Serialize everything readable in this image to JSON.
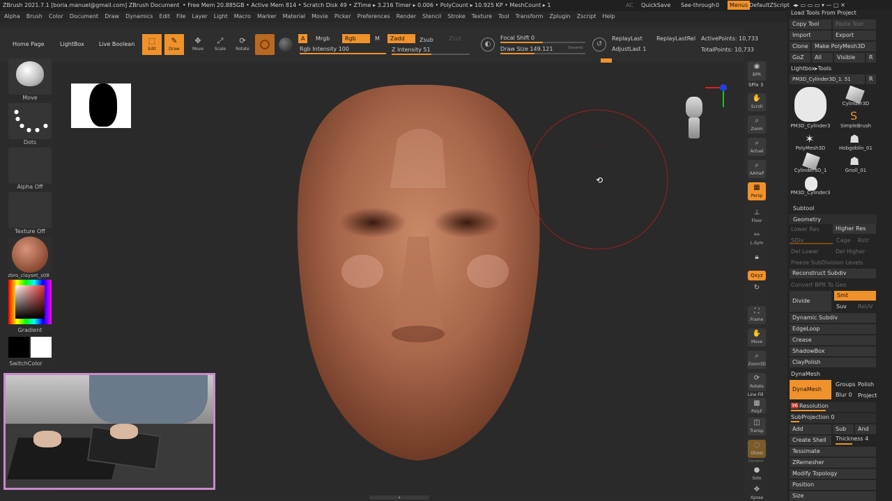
{
  "titlebar": {
    "title": "ZBrush 2021.7.1 [boria.manuel@gmail.com]  ZBrush Document",
    "stats": "• Free Mem 20.885GB • Active Mem 814 • Scratch Disk 49 • ZTime ▸ 3.216 Timer ▸ 0.006 • PolyCount ▸ 10.925 KP • MeshCount ▸ 1",
    "ac": "AC",
    "quicksave": "QuickSave",
    "seethrough": "See-through",
    "seethrough_value": "0",
    "menus": "Menus",
    "zscript": "DefaultZScript"
  },
  "menubar": {
    "items": [
      "Alpha",
      "Brush",
      "Color",
      "Document",
      "Draw",
      "Dynamics",
      "Edit",
      "File",
      "Layer",
      "Light",
      "Macro",
      "Marker",
      "Material",
      "Movie",
      "Picker",
      "Preferences",
      "Render",
      "Stencil",
      "Stroke",
      "Texture",
      "Tool",
      "Transform",
      "Zplugin",
      "Zscript",
      "Help"
    ]
  },
  "toolbar": {
    "home_page": "Home Page",
    "lightbox": "LightBox",
    "live_boolean": "Live Boolean",
    "edit": "Edit",
    "draw": "Draw",
    "move": "Move",
    "scale": "Scale",
    "rotate": "Rotate",
    "a_label": "A",
    "mrgb": "Mrgb",
    "rgb": "Rgb",
    "m": "M",
    "zadd": "Zadd",
    "zsub": "Zsub",
    "zcut": "Zcut",
    "rgb_intensity": "Rgb Intensity 100",
    "z_intensity": "Z Intensity 51",
    "focal_shift": "Focal Shift 0",
    "draw_size": "Draw Size 149.121",
    "dynamic": "Dynamic",
    "replay_last": "ReplayLast",
    "replay_last_rel": "ReplayLastRel",
    "adjust_last": "AdjustLast 1",
    "active_points": "ActivePoints: 10,733",
    "total_points": "TotalPoints: 10,733"
  },
  "leftbar": {
    "move": "Move",
    "dots": "Dots",
    "alpha_off": "Alpha Off",
    "texture_off": "Texture Off",
    "material": "zbro_clayset_s08",
    "gradient": "Gradient",
    "switch_color": "SwitchColor"
  },
  "rightbar": {
    "bpr": "BPR",
    "spix": "SPix 3",
    "scroll": "Scroll",
    "zoom": "Zoom",
    "actual": "Actual",
    "aahalf": "AAHalf",
    "persp": "Persp",
    "floor": "Floor",
    "lsym": "L.Sym",
    "qxyz": "Qxyz",
    "frame": "Frame",
    "move": "Move",
    "zoom3d": "Zoom3D",
    "rotate": "Rotate",
    "linefill": "Line Fill",
    "polyf": "PolyF",
    "transp": "Transp",
    "ghost": "Ghost",
    "dynamic": "Dynamic",
    "solo": "Solo",
    "xpose": "Xpose"
  },
  "panel": {
    "load_tools": "Load Tools From Project",
    "copy_tool": "Copy Tool",
    "paste_tool": "Paste Tool",
    "import": "Import",
    "export": "Export",
    "clone": "Clone",
    "make_polymesh": "Make PolyMesh3D",
    "goz": "GoZ",
    "all": "All",
    "visible": "Visible",
    "r": "R",
    "lightbox_tools": "Lightbox▸Tools",
    "current_tool": "PM3D_Cylinder3D_1. 51",
    "tools": [
      {
        "label": "PM3D_Cylinder3"
      },
      {
        "label": "Cylinder3D"
      },
      {
        "label": "SimpleBrush"
      },
      {
        "label": "PolyMesh3D"
      },
      {
        "label": "Hobgoblin_01"
      },
      {
        "label": "Cylinder3D_1"
      },
      {
        "label": "Gnoll_01"
      },
      {
        "label": "PM3D_Cylinder3"
      }
    ],
    "subtool": "Subtool",
    "geometry": "Geometry",
    "lower_res": "Lower Res",
    "higher_res": "Higher Res",
    "sdiv": "SDiv",
    "cage": "Cage",
    "rstr": "Rstr",
    "del_lower": "Del Lower",
    "del_higher": "Del Higher",
    "freeze_subdiv": "Freeze SubDivision Levels",
    "reconstruct_subdiv": "Reconstruct Subdiv",
    "convert_bpr": "Convert BPR To Geo",
    "divide": "Divide",
    "smt": "Smt",
    "suv": "Suv",
    "reuv": "ReUV",
    "dynamic_subdiv": "Dynamic Subdiv",
    "edgeloop": "EdgeLoop",
    "crease": "Crease",
    "shadowbox": "ShadowBox",
    "claypolish": "ClayPolish",
    "dynamesh_header": "DynaMesh",
    "dynamesh_btn": "DynaMesh",
    "groups": "Groups",
    "polish": "Polish",
    "blur": "Blur 0",
    "project": "Project",
    "resolution_value": "96",
    "resolution": "Resolution",
    "subprojection": "SubProjection 0",
    "add": "Add",
    "sub": "Sub",
    "and": "And",
    "create_shell": "Create Shell",
    "thickness": "Thickness 4",
    "tessimate": "Tessimate",
    "zremesher": "ZRemesher",
    "modify_topology": "Modify Topology",
    "position": "Position",
    "size": "Size"
  },
  "colors": {
    "accent": "#f0922b",
    "clay": "#a8664a",
    "webcam_border": "#c98bc9"
  }
}
